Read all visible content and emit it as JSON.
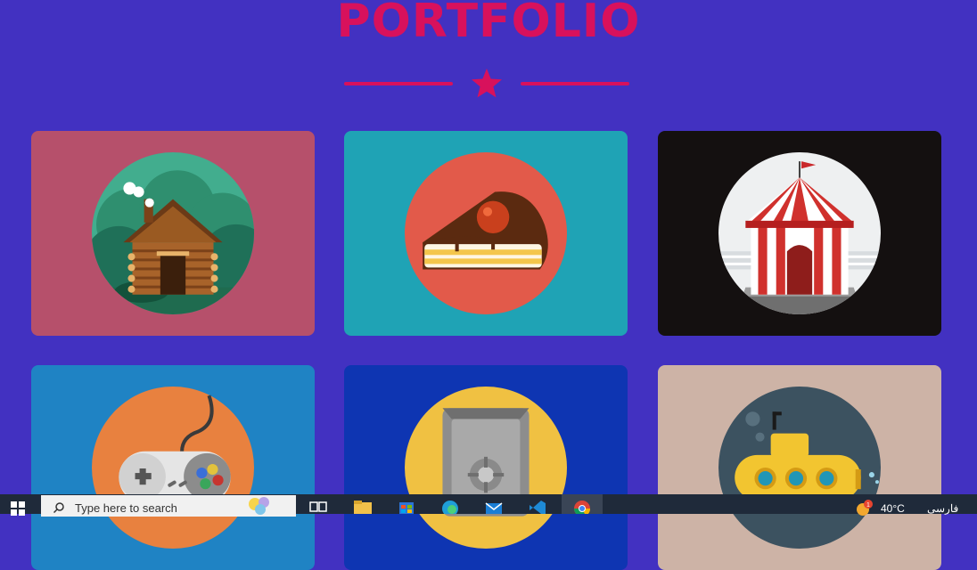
{
  "page": {
    "title": "PORTFOLIO",
    "title_color": "#d8115c",
    "accent_color": "#d8115c",
    "background_color": "#4231c1",
    "divider_icon": "star-icon"
  },
  "portfolio": {
    "items": [
      {
        "name": "cabin",
        "icon": "log-cabin-icon",
        "bg": "#b6506b"
      },
      {
        "name": "cake",
        "icon": "cake-slice-icon",
        "bg": "#1fa3b5"
      },
      {
        "name": "circus",
        "icon": "circus-tent-icon",
        "bg": "#141010"
      },
      {
        "name": "game",
        "icon": "game-controller-icon",
        "bg": "#1f83c4"
      },
      {
        "name": "safe",
        "icon": "safe-icon",
        "bg": "#0e35b2"
      },
      {
        "name": "submarine",
        "icon": "submarine-icon",
        "bg": "#cdb3a6"
      }
    ]
  },
  "taskbar": {
    "search_placeholder": "Type here to search",
    "weather_badge": "1",
    "temperature": "40°C",
    "language": "فارسی",
    "apps": [
      "task-view-icon",
      "file-explorer-icon",
      "store-icon",
      "edge-icon",
      "mail-icon",
      "vscode-icon",
      "chrome-icon"
    ]
  }
}
